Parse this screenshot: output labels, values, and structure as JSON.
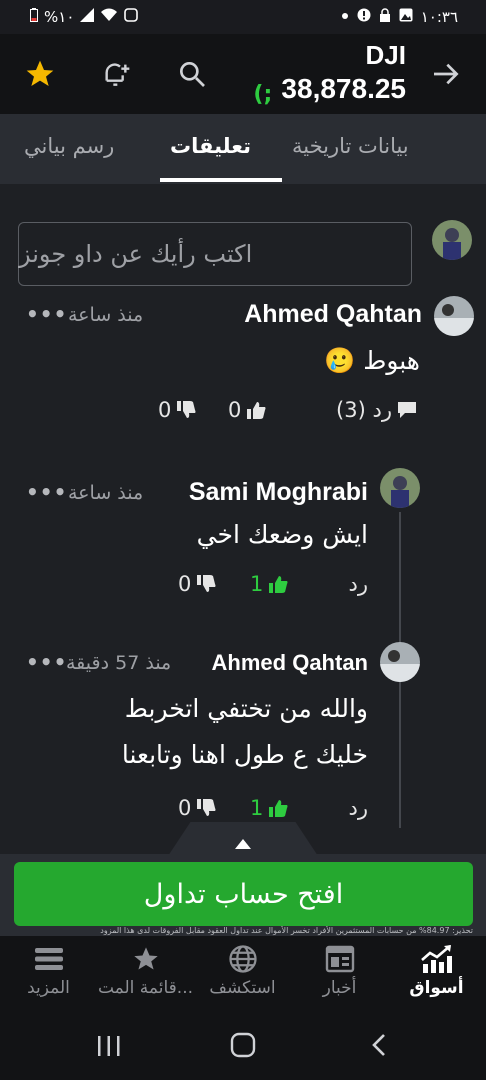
{
  "status_bar": {
    "time": "١٠:٣٦",
    "battery": "%١٠"
  },
  "header": {
    "symbol": "DJI",
    "price": "38,878.25",
    "change_fragment": "(;"
  },
  "tabs": [
    {
      "label": "رسم بياني",
      "active": false
    },
    {
      "label": "تعليقات",
      "active": true
    },
    {
      "label": "بيانات تاريخية",
      "active": false
    }
  ],
  "comment_input": {
    "placeholder": "اكتب رأيك عن داو جونز"
  },
  "comments": [
    {
      "author": "Ahmed Qahtan",
      "time": "منذ ساعة",
      "lines": [
        "هبوط 🥲"
      ],
      "reply_label": "رد (3)",
      "likes": "0",
      "dislikes": "0"
    },
    {
      "author": "Sami Moghrabi",
      "time": "منذ ساعة",
      "lines": [
        "ايش وضعك اخي"
      ],
      "reply_label": "رد",
      "likes": "1",
      "dislikes": "0"
    },
    {
      "author": "Ahmed Qahtan",
      "time": "منذ 57 دقيقة",
      "lines": [
        "والله من تختفي اتخربط",
        "خليك ع طول اهنا وتابعنا"
      ],
      "reply_label": "رد",
      "likes": "1",
      "dislikes": "0"
    }
  ],
  "cta": {
    "label": "افتح حساب تداول",
    "fine_print": "تحذير: 84.97% من حسابات المستثمرين الأفراد تخسر الأموال عند تداول العقود مقابل الفروقات لدى هذا المزود"
  },
  "bottom_nav": [
    {
      "label": "المزيد",
      "icon": "menu-icon",
      "active": false
    },
    {
      "label": "قائمة المت...",
      "icon": "star-icon",
      "active": false
    },
    {
      "label": "استكشف",
      "icon": "globe-icon",
      "active": false
    },
    {
      "label": "أخبار",
      "icon": "news-icon",
      "active": false
    },
    {
      "label": "أسواق",
      "icon": "markets-chart-icon",
      "active": true
    }
  ],
  "colors": {
    "accent_green": "#25a82f",
    "positive": "#2ecc40",
    "star": "#f5b800"
  }
}
